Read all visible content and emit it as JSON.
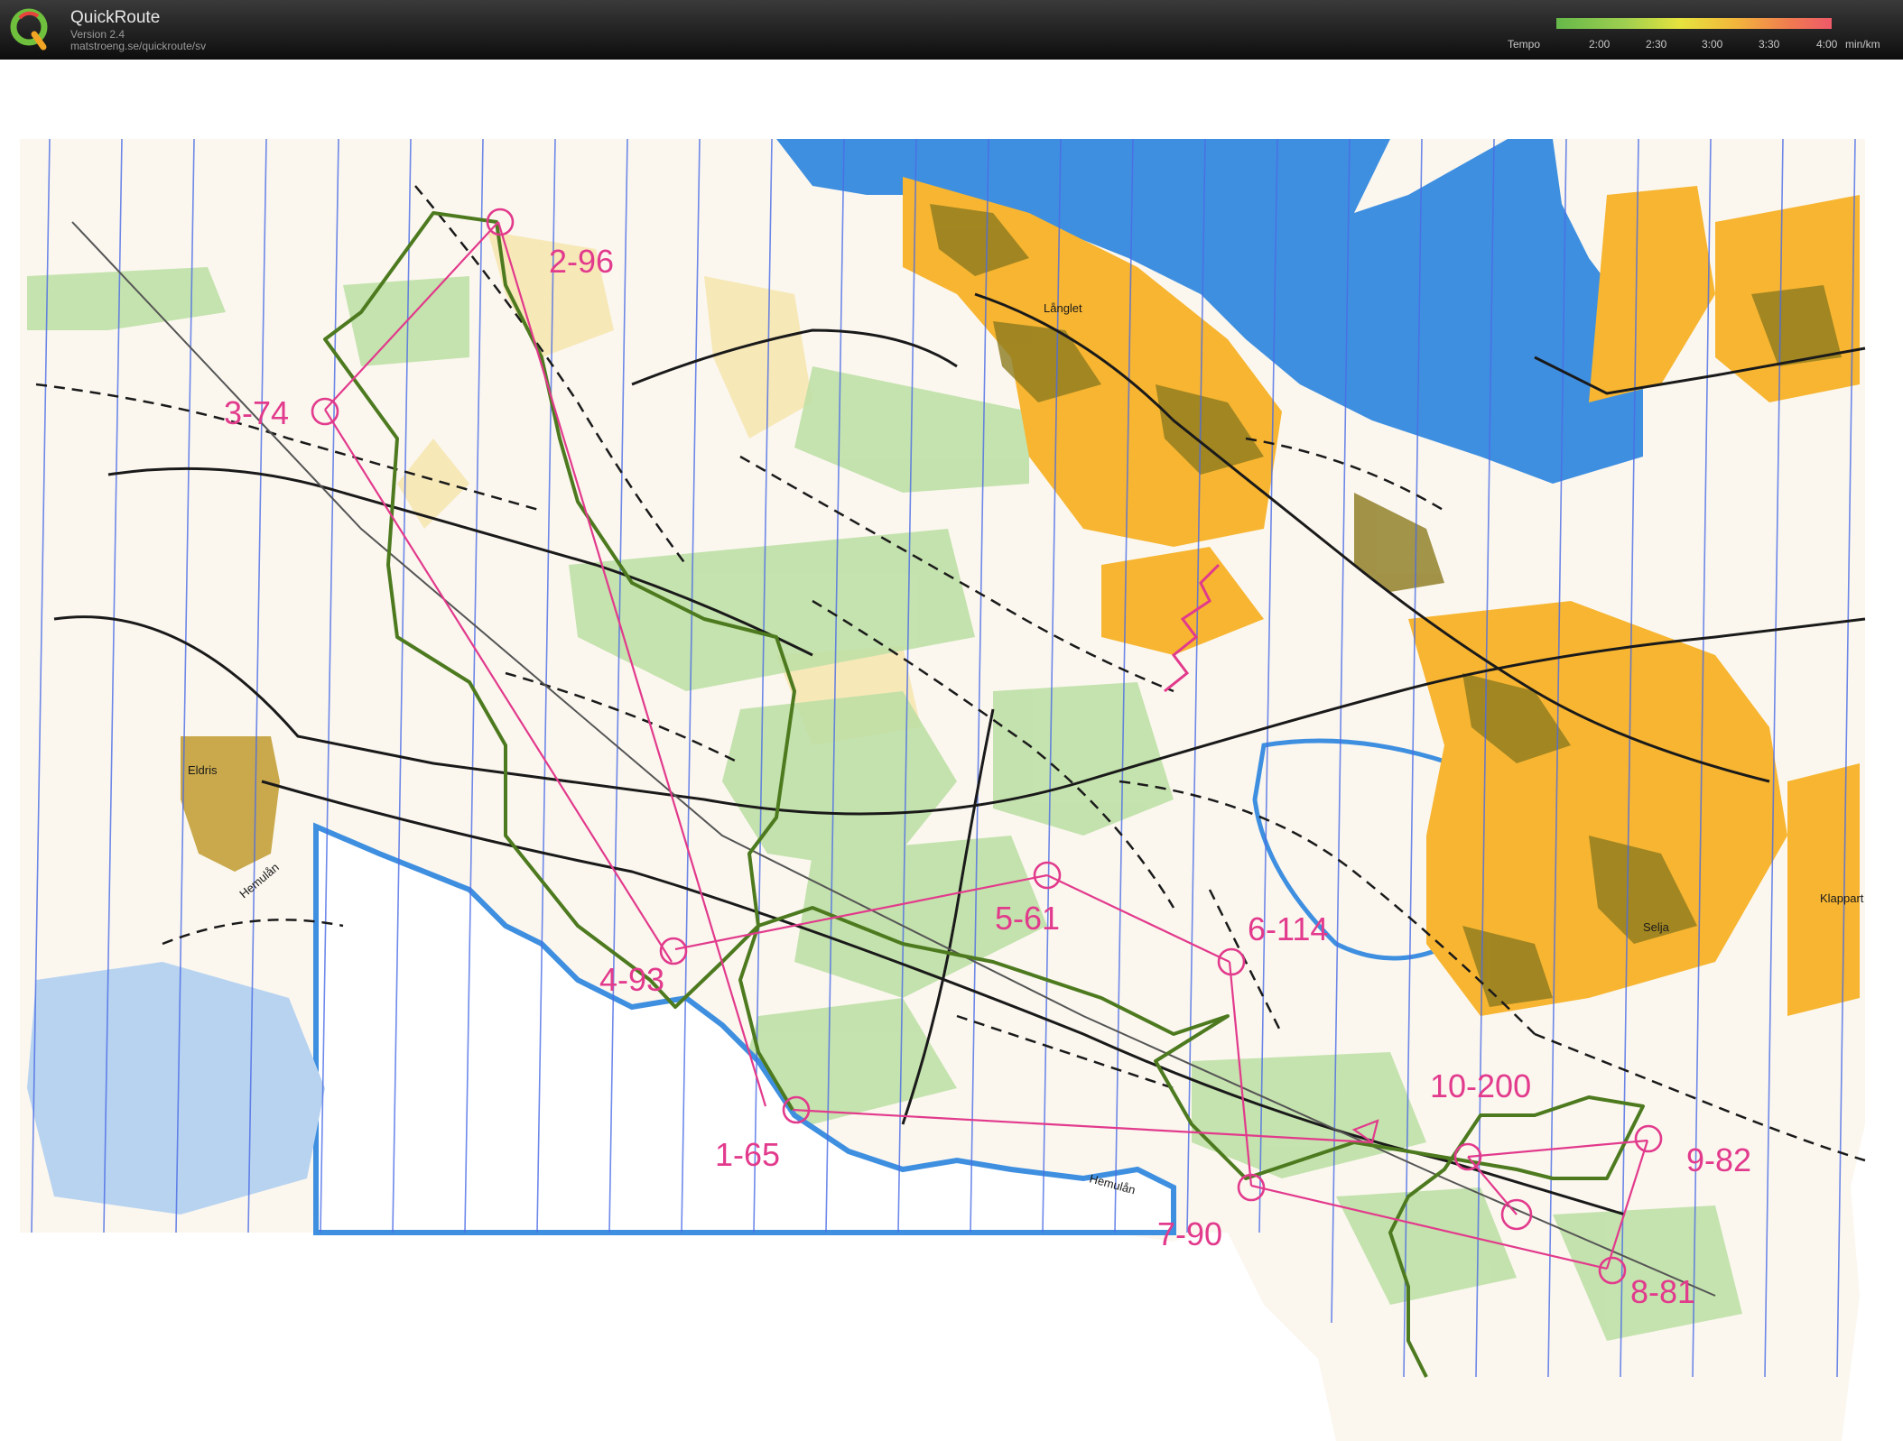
{
  "header": {
    "app_name": "QuickRoute",
    "version": "Version 2.4",
    "url": "matstroeng.se/quickroute/sv",
    "tempo_label": "Tempo",
    "scale_ticks": [
      "2:00",
      "2:30",
      "3:00",
      "3:30",
      "4:00"
    ],
    "scale_unit": "min/km"
  },
  "map": {
    "places": {
      "langlet": "Långlet",
      "eldris": "Eldris",
      "selja": "Selja",
      "klappart": "Klappart",
      "hemulan_1": "Hemulån",
      "hemulan_2": "Hemulån"
    },
    "controls": [
      {
        "label": "2-96"
      },
      {
        "label": "3-74"
      },
      {
        "label": "4-93"
      },
      {
        "label": "5-61"
      },
      {
        "label": "6-114"
      },
      {
        "label": "1-65"
      },
      {
        "label": "7-90"
      },
      {
        "label": "8-81"
      },
      {
        "label": "9-82"
      },
      {
        "label": "10-200"
      }
    ],
    "colors": {
      "course": "#e23a8c",
      "route": "#4d7a1f",
      "water": "#3f8fe0",
      "urban": "#f7b531",
      "forest_green": "#bfe0a6",
      "magnetic_lines": "#4b6ce6"
    }
  }
}
